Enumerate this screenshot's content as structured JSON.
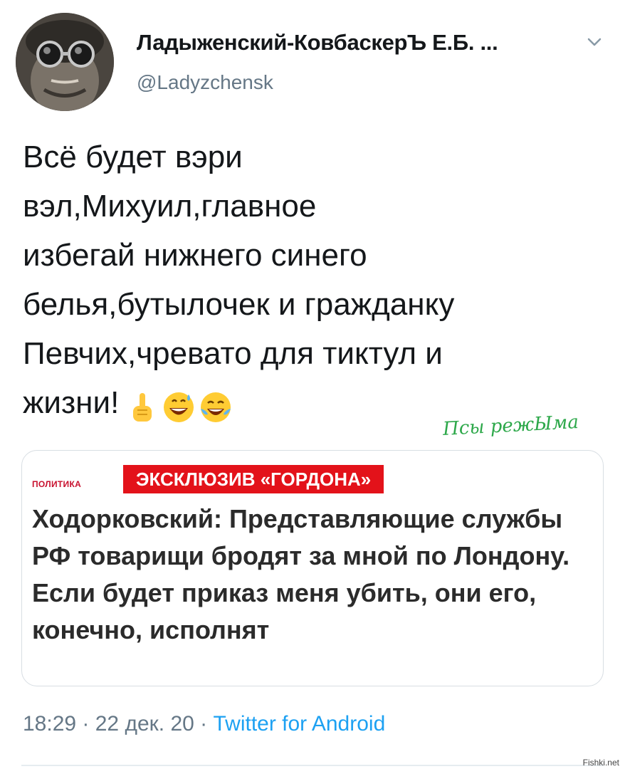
{
  "author": {
    "display_name": "Ладыженский-КовбаскерЪ Е.Б. ...",
    "handle": "@Ladyzchensk"
  },
  "tweet": {
    "text": "Всё будет вэри\nвэл,Михуил,главное\nизбегай нижнего синего\nбелья,бутылочек и гражданку\nПевчих,чревато для тиктул и\nжизни!",
    "emojis": [
      "pointing-up-icon",
      "grinning-sweat-icon",
      "tears-of-joy-icon"
    ]
  },
  "watermark": "Псы режЫма",
  "card": {
    "section": "ПОЛИТИКА",
    "badge": "ЭКСКЛЮЗИВ «ГОРДОНА»",
    "headline": "Ходорковский: Представляющие службы РФ товарищи бродят за мной по Лондону. Если будет приказ меня убить, они его, конечно, исполнят"
  },
  "meta": {
    "time": "18:29",
    "date": "22 дек. 20",
    "separator": " · ",
    "source": "Twitter for Android"
  },
  "site_mark": "Fishki.net",
  "colors": {
    "accent": "#1da1f2",
    "muted": "#657786",
    "badge_red": "#e3121a"
  }
}
